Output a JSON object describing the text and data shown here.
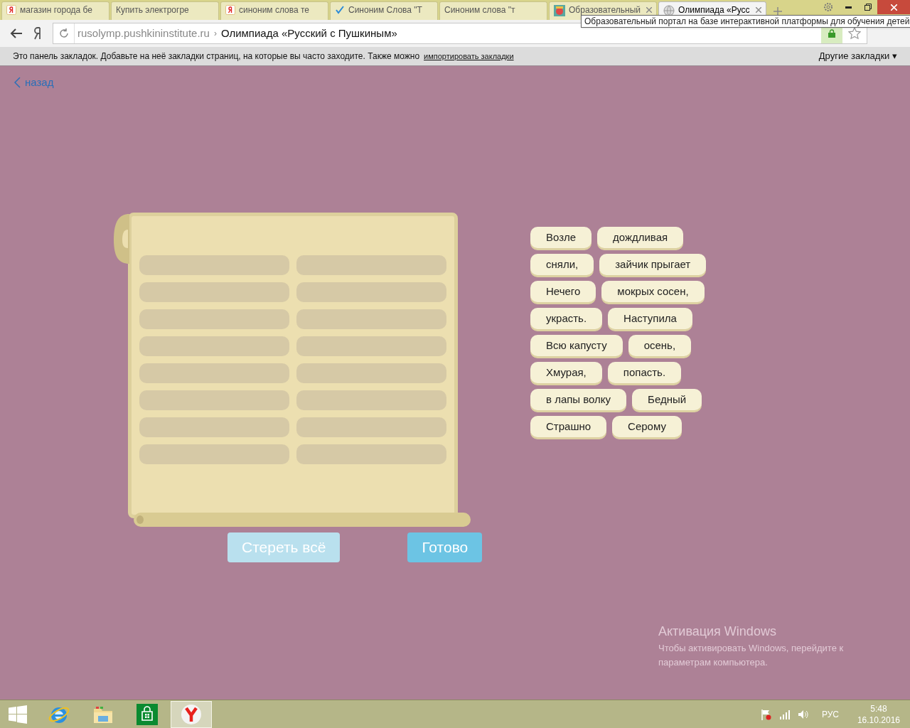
{
  "tabs": [
    {
      "kind": "yandex",
      "title": "магазин города бе",
      "selected": false,
      "closable": false
    },
    {
      "kind": "news",
      "title": "Купить электрогре",
      "selected": false,
      "closable": false
    },
    {
      "kind": "yandex",
      "title": "синоним слова те",
      "selected": false,
      "closable": false
    },
    {
      "kind": "check",
      "title": "Синоним Слова \"Т",
      "selected": false,
      "closable": false
    },
    {
      "kind": "answers",
      "title": "Синоним слова \"т",
      "selected": false,
      "closable": false
    },
    {
      "kind": "portal",
      "title": "Образовательный",
      "selected": false,
      "closable": true
    },
    {
      "kind": "globe",
      "title": "Олимпиада «Русс",
      "selected": true,
      "closable": true
    }
  ],
  "tooltip": "Образовательный портал на базе интерактивной платформы для обучения детей",
  "address": {
    "host": "rusolymp.pushkininstitute.ru",
    "separator": "›",
    "page_title": "Олимпиада «Русский с Пушкиным»"
  },
  "bookmarks_bar": {
    "message": "Это панель закладок. Добавьте на неё закладки страниц, на которые вы часто заходите. Также можно",
    "link": "импортировать закладки",
    "other": "Другие закладки ▾"
  },
  "back_link": "назад",
  "word_rows": [
    [
      "Возле",
      "дождливая"
    ],
    [
      "сняли,",
      "зайчик прыгает"
    ],
    [
      "Нечего",
      "мокрых сосен,"
    ],
    [
      "украсть.",
      "Наступила"
    ],
    [
      "Всю капусту",
      "осень,"
    ],
    [
      "Хмурая,",
      "попасть."
    ],
    [
      "в лапы волку",
      "Бедный"
    ],
    [
      "Страшно",
      "Серому"
    ]
  ],
  "buttons": [
    {
      "label": "Стереть всё",
      "disabled": true
    },
    {
      "label": "Готово",
      "disabled": false
    }
  ],
  "activation": {
    "title": "Активация Windows",
    "text": "Чтобы активировать Windows, перейдите к параметрам компьютера."
  },
  "taskbar": {
    "apps": [
      {
        "kind": "ie",
        "selected": false
      },
      {
        "kind": "explorer",
        "selected": false
      },
      {
        "kind": "store",
        "selected": false
      },
      {
        "kind": "yandex",
        "selected": true
      }
    ],
    "language": "РУС",
    "time": "5:48",
    "date": "16.10.2016"
  }
}
